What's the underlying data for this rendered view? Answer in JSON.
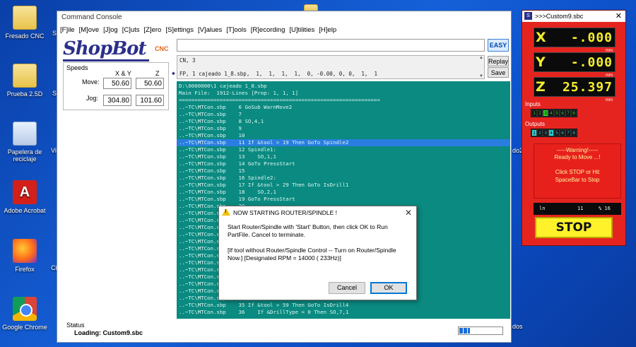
{
  "desktop": {
    "icons": [
      {
        "label": "Fresado CNC"
      },
      {
        "label": "Prueba 2.5D"
      },
      {
        "label": "Papelera de reciclaje"
      },
      {
        "label": "Adobe Acrobat"
      },
      {
        "label": "Firefox"
      },
      {
        "label": "Google Chrome"
      }
    ],
    "peek_labels": [
      "S",
      "Vi",
      "Ci",
      "S",
      "do2",
      "dos"
    ]
  },
  "console": {
    "title": "Command Console",
    "menu": [
      "[F]ile",
      "[M]ove",
      "[J]og",
      "[C]uts",
      "[Z]ero",
      "[S]ettings",
      "[V]alues",
      "[T]ools",
      "[R]ecording",
      "[U]tilities",
      "[H]elp"
    ],
    "logo_text": "ShopBot",
    "logo_suffix": "CNC",
    "speeds": {
      "title": "Speeds",
      "col_xy": "X & Y",
      "col_z": "Z",
      "move_label": "Move:",
      "jog_label": "Jog:",
      "move_xy": "50.60",
      "move_z": "50.60",
      "jog_xy": "304.80",
      "jog_z": "101.60"
    },
    "command_input": "",
    "easy_label": "EASY",
    "replay_label": "Replay",
    "save_label": "Save",
    "history": [
      "CN, 3",
      "FP, 1 cajeado 1_8.sbp,  1,  1,  1,  1,  0, -0.00, 0, 0,  1,  1"
    ],
    "output_lines": [
      "D:\\0000000\\1 cajeado 1_8.sbp",
      "Main File:  1912-Lines [Prop: 1, 1, 1]",
      "================================================================",
      "..~TC\\MTCon.sbp    6 GoSub WarnMove2",
      "..~TC\\MTCon.sbp    7",
      "..~TC\\MTCon.sbp    8 SO,4,1",
      "..~TC\\MTCon.sbp    9",
      "..~TC\\MTCon.sbp    10",
      "..~TC\\MTCon.sbp    11 If &tool > 19 Then GoTo Spindle2",
      "..~TC\\MTCon.sbp    12 Spindle1:",
      "..~TC\\MTCon.sbp    13    SO,1,1",
      "..~TC\\MTCon.sbp    14 GoTo PressStart",
      "..~TC\\MTCon.sbp    15",
      "..~TC\\MTCon.sbp    16 Spindle2:",
      "..~TC\\MTCon.sbp    17 If &tool > 29 Then GoTo IsDrill1",
      "..~TC\\MTCon.sbp    18    SO,2,1",
      "..~TC\\MTCon.sbp    19 GoTo PressStart",
      "..~TC\\MTCon.sbp    20",
      "..~TC\\MTCon.sbp",
      "..~TC\\MTCon.sbp",
      "..~TC\\MTCon.sbp",
      "..~TC\\MTCon.sbp",
      "..~TC\\MTCon.sbp",
      "..~TC\\MTCon.sbp",
      "..~TC\\MTCon.sbp",
      "..~TC\\MTCon.sbp",
      "..~TC\\MTCon.sbp",
      "..~TC\\MTCon.sbp",
      "..~TC\\MTCon.sbp",
      "..~TC\\MTCon.sbp",
      "..~TC\\MTCon.sbp",
      "..~TC\\MTCon.sbp    35 If &tool > 59 Then GoTo IsDrill4",
      "..~TC\\MTCon.sbp    36    If &DrillType = 0 Then SO,7,1"
    ],
    "highlight_line": 8,
    "status_caption": "Status",
    "status_value": "Loading: Custom9.sbc",
    "progress": 0.25
  },
  "dialog": {
    "title": "NOW STARTING ROUTER/SPINDLE !",
    "message1": "Start Router/Spindle with 'Start' Button, then click OK to Run PartFile. Cancel to terminate.",
    "message2": "[If tool without Router/Spindle Control -- Turn on Router/Spindle Now.]  [Designated RPM = 14000 ( 233Hz)]",
    "cancel_label": "Cancel",
    "ok_label": "OK"
  },
  "position_window": {
    "title": ">>>Custom9.sbc",
    "app_icon": "S",
    "x_label": "X",
    "x_value": "-.000",
    "y_label": "Y",
    "y_value": "-.000",
    "z_label": "Z",
    "z_value": "25.397",
    "unit": "mm",
    "inputs_label": "Inputs",
    "outputs_label": "Outputs",
    "inputs": [
      {
        "n": "1",
        "on": false
      },
      {
        "n": "2",
        "on": false
      },
      {
        "n": "3",
        "on": true
      },
      {
        "n": "4",
        "on": false
      },
      {
        "n": "5",
        "on": false
      },
      {
        "n": "6",
        "on": false
      },
      {
        "n": "7",
        "on": false
      },
      {
        "n": "8",
        "on": false
      }
    ],
    "outputs": [
      {
        "n": "1",
        "on": true
      },
      {
        "n": "2",
        "on": false
      },
      {
        "n": "3",
        "on": false
      },
      {
        "n": "4",
        "on": true
      },
      {
        "n": "5",
        "on": false
      },
      {
        "n": "6",
        "on": false
      },
      {
        "n": "7",
        "on": false
      },
      {
        "n": "8",
        "on": false
      }
    ],
    "warning_title": "-----Warning!-----",
    "warning_line2": "Ready to Move ...!",
    "warning_line3": "Click STOP or Hit",
    "warning_line4": "SpaceBar to Stop",
    "line_ln": "ln",
    "line_num": "11",
    "line_pct": "% 16",
    "stop_label": "STOP",
    "colors": {
      "panel": "#e52420",
      "digits": "#f6ee2a",
      "stop": "#fff22a"
    }
  }
}
